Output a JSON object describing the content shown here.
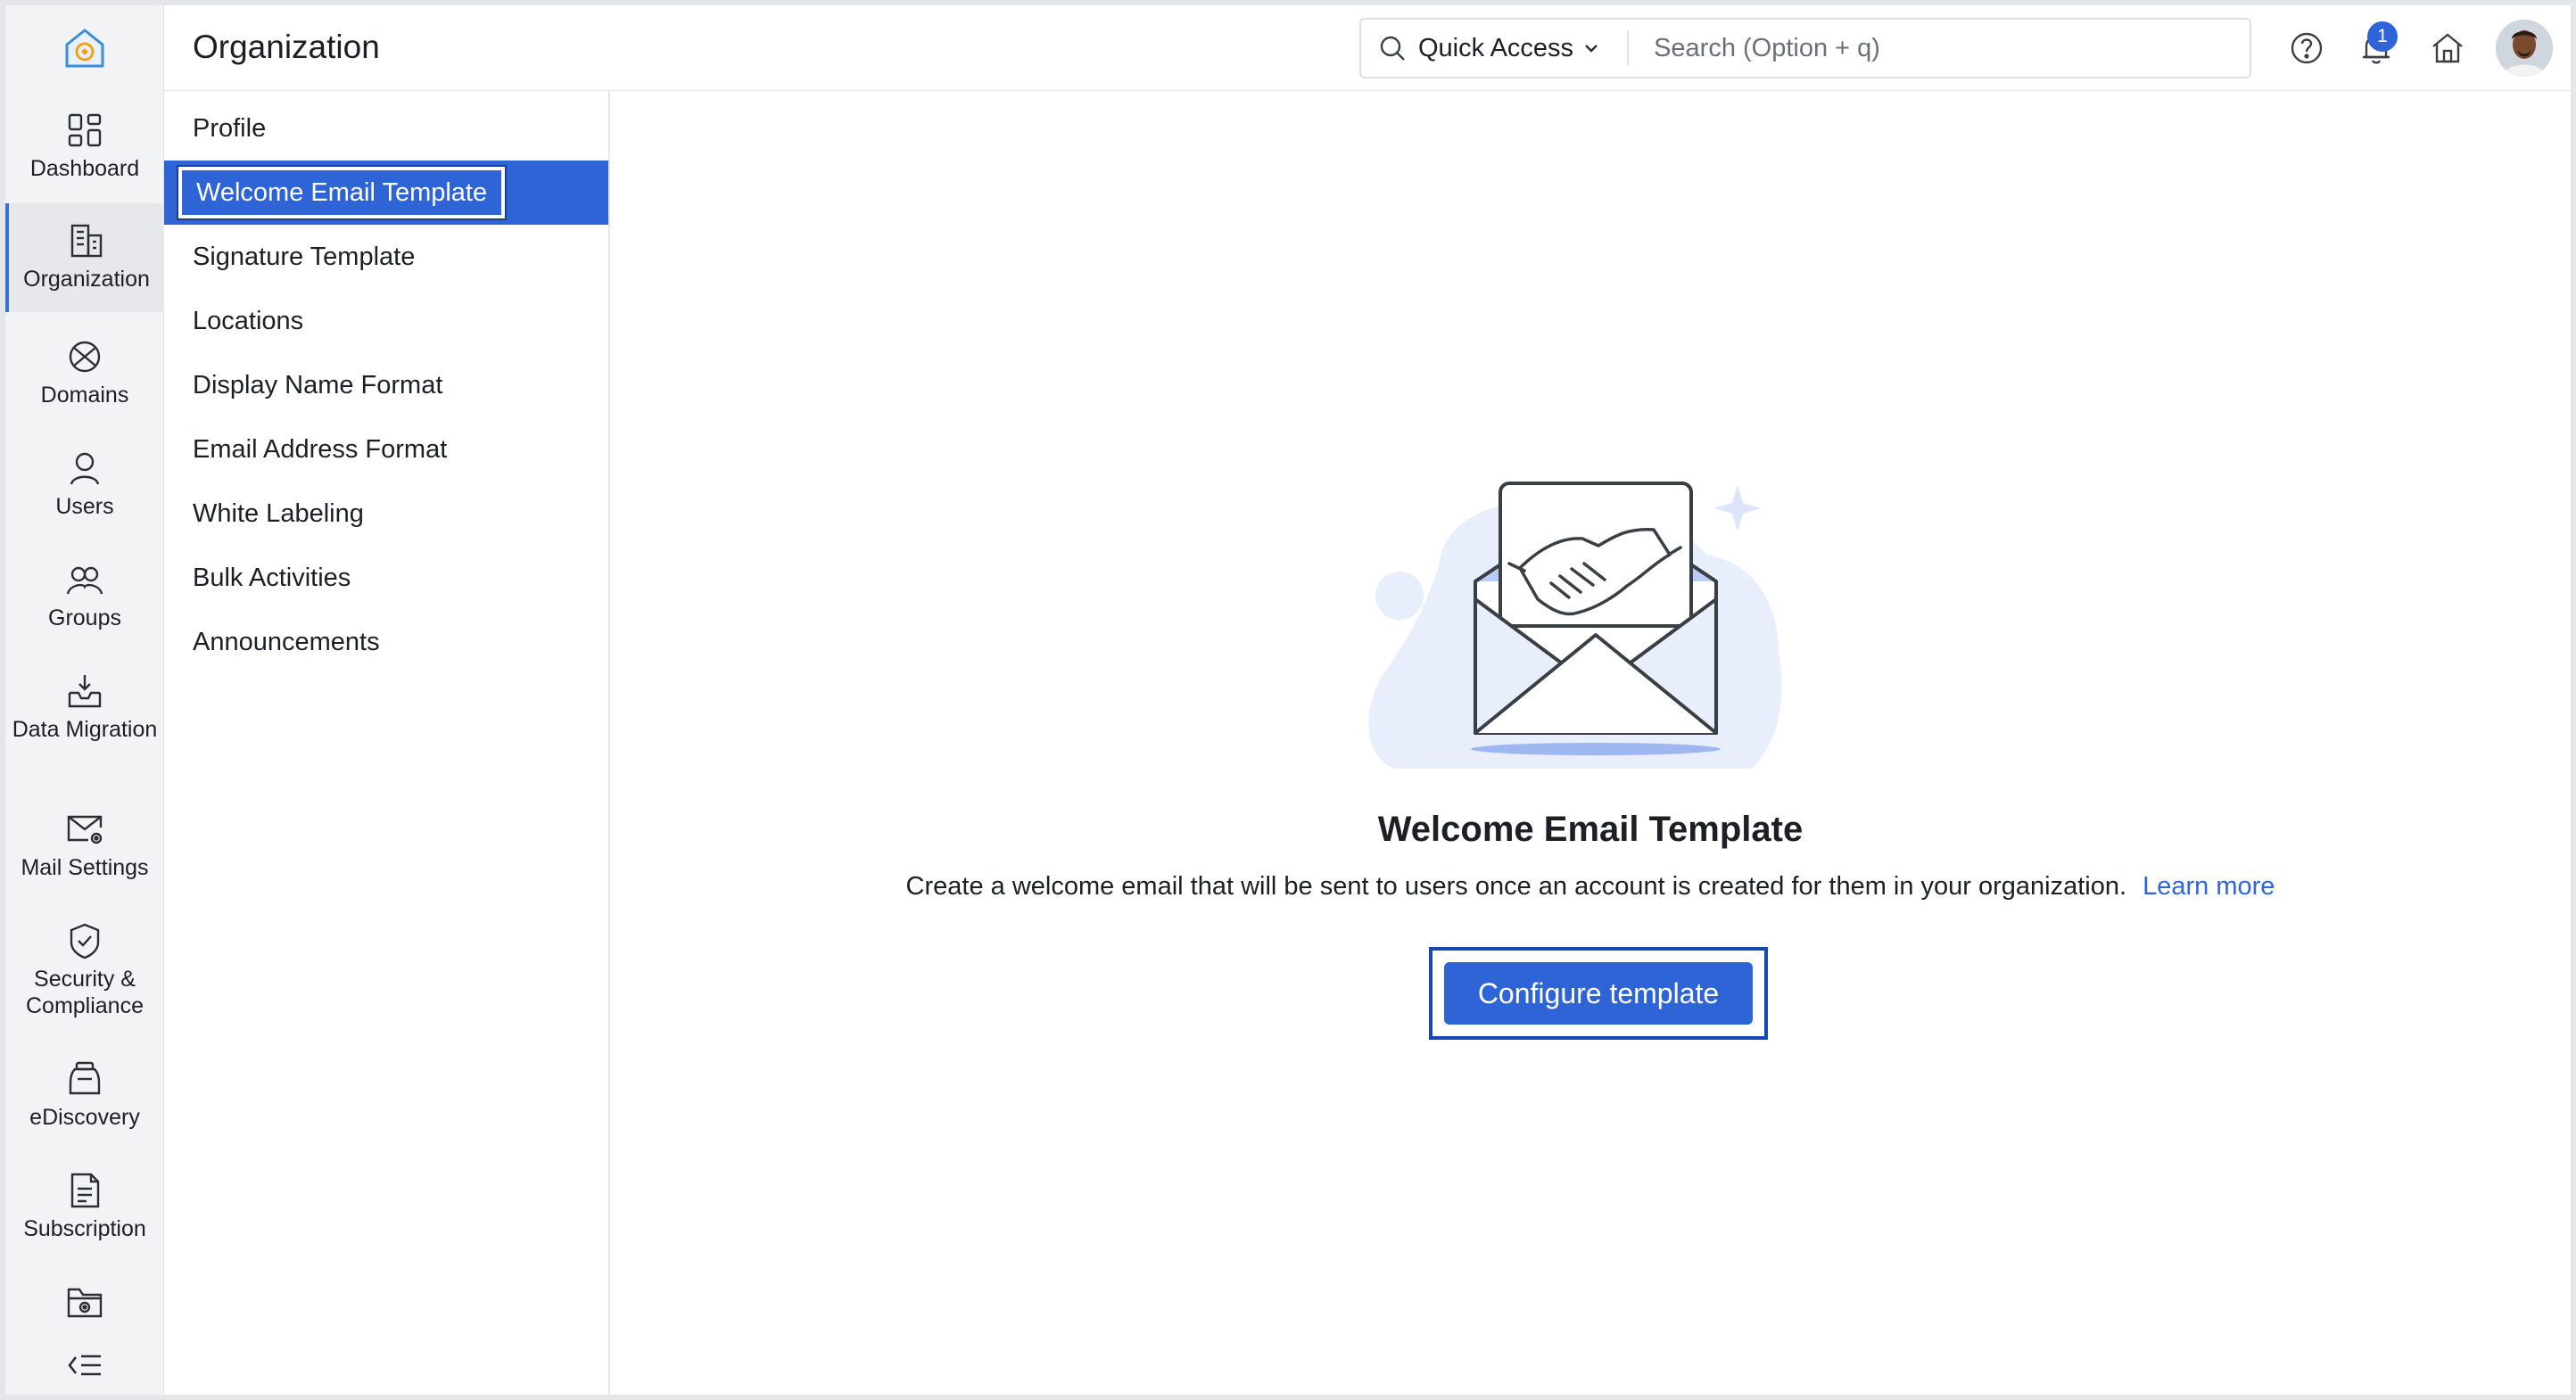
{
  "header": {
    "title": "Organization",
    "quick_access_label": "Quick Access",
    "search_placeholder": "Search (Option + q)",
    "notification_count": "1"
  },
  "rail": {
    "items": [
      {
        "label": "Dashboard",
        "icon": "dashboard-icon"
      },
      {
        "label": "Organization",
        "icon": "building-icon",
        "active": true
      },
      {
        "label": "Domains",
        "icon": "globe-icon"
      },
      {
        "label": "Users",
        "icon": "user-icon"
      },
      {
        "label": "Groups",
        "icon": "users-icon"
      },
      {
        "label": "Data Migration",
        "icon": "inbox-download-icon"
      },
      {
        "label": "Mail Settings",
        "icon": "mail-gear-icon"
      },
      {
        "label": "Security & Compliance",
        "icon": "shield-check-icon"
      },
      {
        "label": "eDiscovery",
        "icon": "jar-icon"
      },
      {
        "label": "Subscription",
        "icon": "invoice-icon"
      }
    ]
  },
  "subnav": {
    "items": [
      "Profile",
      "Welcome Email Template",
      "Signature Template",
      "Locations",
      "Display Name Format",
      "Email Address Format",
      "White Labeling",
      "Bulk Activities",
      "Announcements"
    ],
    "active_index": 1
  },
  "main": {
    "title": "Welcome Email Template",
    "description": "Create a welcome email that will be sent to users once an account is created for them in your organization.",
    "learn_more": "Learn more",
    "cta_label": "Configure template"
  },
  "colors": {
    "accent": "#2f64d6",
    "rail_bg": "#f2f3f5",
    "illustration_bg": "#e8eefc"
  }
}
